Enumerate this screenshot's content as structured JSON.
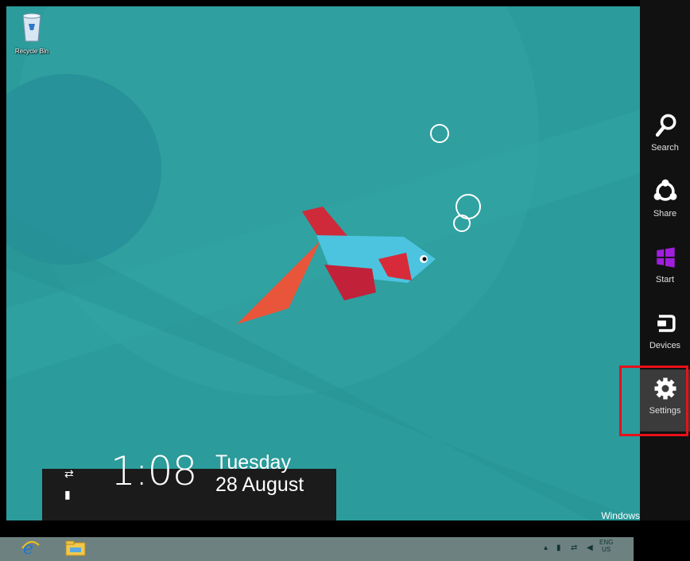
{
  "desktop": {
    "recycle_bin_label": "Recycle Bin",
    "watermark": "Windows"
  },
  "clock": {
    "time": "1:08",
    "day": "Tuesday",
    "date": "28 August"
  },
  "taskbar": {
    "apps": [
      {
        "name": "Internet Explorer",
        "icon": "ie-icon"
      },
      {
        "name": "File Explorer",
        "icon": "folder-icon"
      }
    ],
    "tray": {
      "language": "ENG",
      "region": "US"
    }
  },
  "charms": {
    "items": [
      {
        "label": "Search",
        "icon": "search-icon"
      },
      {
        "label": "Share",
        "icon": "share-icon"
      },
      {
        "label": "Start",
        "icon": "windows-logo-icon"
      },
      {
        "label": "Devices",
        "icon": "devices-icon"
      },
      {
        "label": "Settings",
        "icon": "gear-icon",
        "selected": true
      }
    ],
    "highlight_color": "#e8101b",
    "start_color": "#a01edc"
  },
  "colors": {
    "wallpaper": "#2a9a9a",
    "charm_bar": "#111111"
  }
}
